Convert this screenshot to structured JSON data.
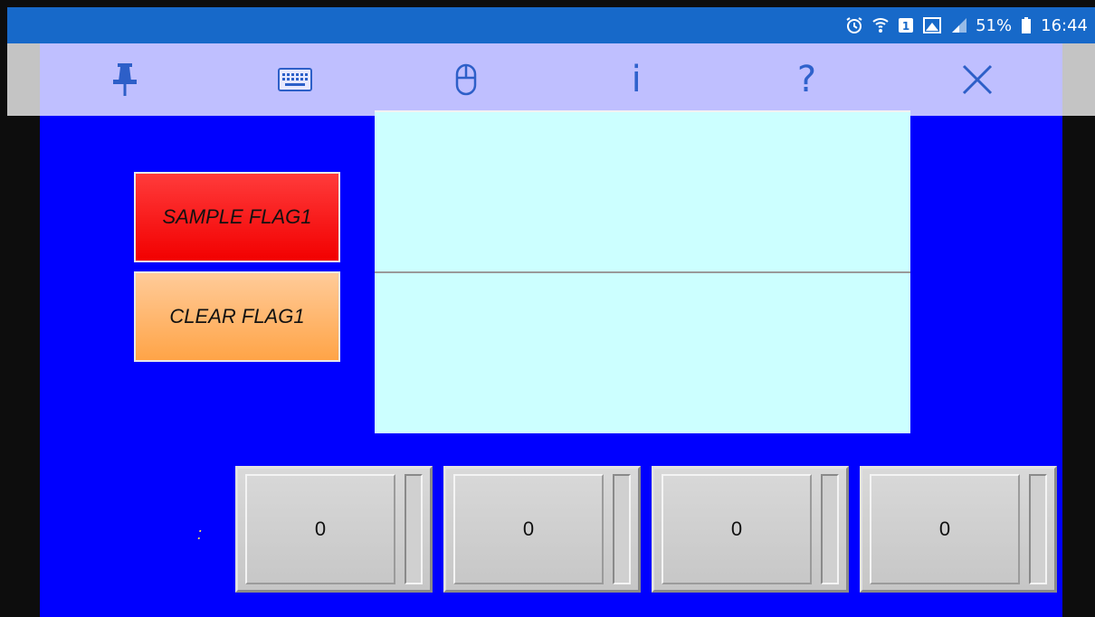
{
  "status_bar": {
    "battery": "51%",
    "time": "16:44",
    "icons": [
      "alarm-icon",
      "wifi-icon",
      "notification-icon",
      "gallery-icon",
      "signal-icon",
      "battery-icon"
    ]
  },
  "toolbar": {
    "buttons": [
      {
        "name": "pin",
        "icon": "pin-icon"
      },
      {
        "name": "keyboard",
        "icon": "keyboard-icon"
      },
      {
        "name": "mouse",
        "icon": "mouse-icon"
      },
      {
        "name": "info",
        "label": "i"
      },
      {
        "name": "help",
        "label": "?"
      },
      {
        "name": "close",
        "icon": "close-icon"
      }
    ]
  },
  "hmi": {
    "sample_flag_label": "SAMPLE FLAG1",
    "clear_flag_label": "CLEAR FLAG1",
    "colon_label": ":",
    "values": [
      "0",
      "0",
      "0",
      "0"
    ]
  },
  "colors": {
    "background": "#0000ff",
    "toolbar": "#bfbfff",
    "status_bar": "#1769c9",
    "sample_flag": "#ff0000",
    "clear_flag": "#ffb060",
    "display_panel": "#ccffff"
  }
}
